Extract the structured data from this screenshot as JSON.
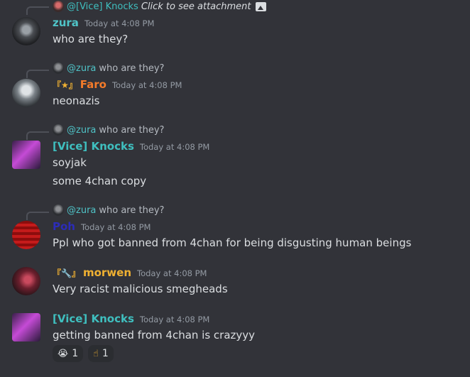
{
  "colors": {
    "background": "#323339",
    "vice_knocks": "#3fbfbf",
    "zura": "#4fc3c7",
    "faro": "#f47b2a",
    "poh": "#2c2cb8",
    "morwen": "#f0b132",
    "timestamp": "#949ba4"
  },
  "messages": [
    {
      "reply_mention": "@[Vice] Knocks",
      "reply_text": "Click to see attachment",
      "reply_icon": "image-icon",
      "username": "zura",
      "timestamp": "Today at 4:08 PM",
      "lines": [
        "who are they?"
      ]
    },
    {
      "reply_mention": "@zura",
      "reply_text": "who are they?",
      "role_icon": "『★』",
      "username": "Faro",
      "timestamp": "Today at 4:08 PM",
      "lines": [
        "neonazis"
      ]
    },
    {
      "reply_mention": "@zura",
      "reply_text": "who are they?",
      "username": "[Vice] Knocks",
      "timestamp": "Today at 4:08 PM",
      "lines": [
        "soyjak",
        "some 4chan copy"
      ]
    },
    {
      "reply_mention": "@zura",
      "reply_text": "who are they?",
      "username": "Poh",
      "timestamp": "Today at 4:08 PM",
      "lines": [
        "Ppl who got banned from 4chan for being disgusting human beings"
      ]
    },
    {
      "role_icon": "『🔧』",
      "username": "morwen",
      "timestamp": "Today at 4:08 PM",
      "lines": [
        "Very racist malicious smegheads"
      ]
    },
    {
      "username": "[Vice] Knocks",
      "timestamp": "Today at 4:08 PM",
      "lines": [
        "getting banned from 4chan is crazyyy"
      ],
      "reactions": [
        {
          "emoji": "😭",
          "count": "1"
        },
        {
          "emoji": "☝",
          "count": "1"
        }
      ]
    }
  ]
}
